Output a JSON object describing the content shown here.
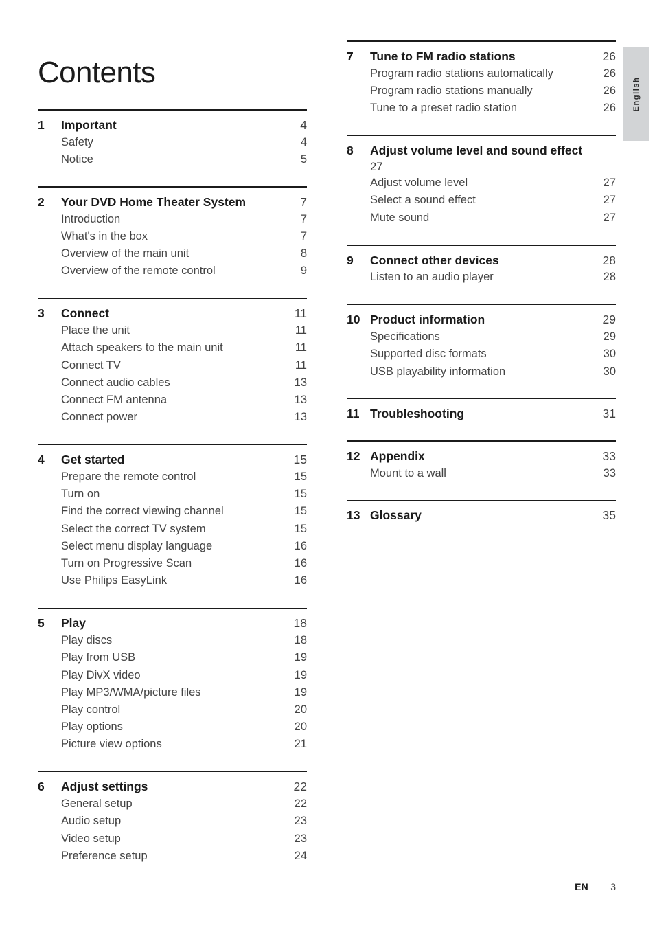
{
  "page_title": "Contents",
  "language_tab": "English",
  "footer": {
    "locale": "EN",
    "page_number": "3"
  },
  "columns": [
    {
      "id": "left",
      "sections": [
        {
          "number": "1",
          "title": "Important",
          "page": "4",
          "entries": [
            {
              "label": "Safety",
              "page": "4"
            },
            {
              "label": "Notice",
              "page": "5"
            }
          ]
        },
        {
          "number": "2",
          "title": "Your DVD Home Theater System",
          "page": "7",
          "entries": [
            {
              "label": "Introduction",
              "page": "7"
            },
            {
              "label": "What's in the box",
              "page": "7"
            },
            {
              "label": "Overview of the main unit",
              "page": "8"
            },
            {
              "label": "Overview of the remote control",
              "page": "9"
            }
          ]
        },
        {
          "number": "3",
          "title": "Connect",
          "page": "11",
          "entries": [
            {
              "label": "Place the unit",
              "page": "11"
            },
            {
              "label": "Attach speakers to the main unit",
              "page": "11"
            },
            {
              "label": "Connect TV",
              "page": "11"
            },
            {
              "label": "Connect audio cables",
              "page": "13"
            },
            {
              "label": "Connect FM antenna",
              "page": "13"
            },
            {
              "label": "Connect power",
              "page": "13"
            }
          ]
        },
        {
          "number": "4",
          "title": "Get started",
          "page": "15",
          "entries": [
            {
              "label": "Prepare the remote control",
              "page": "15"
            },
            {
              "label": "Turn on",
              "page": "15"
            },
            {
              "label": "Find the correct viewing channel",
              "page": "15"
            },
            {
              "label": "Select the correct TV system",
              "page": "15"
            },
            {
              "label": "Select menu display language",
              "page": "16"
            },
            {
              "label": "Turn on Progressive Scan",
              "page": "16"
            },
            {
              "label": "Use Philips EasyLink",
              "page": "16"
            }
          ]
        },
        {
          "number": "5",
          "title": "Play",
          "page": "18",
          "entries": [
            {
              "label": "Play discs",
              "page": "18"
            },
            {
              "label": "Play from USB",
              "page": "19"
            },
            {
              "label": "Play DivX video",
              "page": "19"
            },
            {
              "label": "Play MP3/WMA/picture files",
              "page": "19"
            },
            {
              "label": "Play control",
              "page": "20"
            },
            {
              "label": "Play options",
              "page": "20"
            },
            {
              "label": "Picture view options",
              "page": "21"
            }
          ]
        },
        {
          "number": "6",
          "title": "Adjust settings",
          "page": "22",
          "entries": [
            {
              "label": "General setup",
              "page": "22"
            },
            {
              "label": "Audio setup",
              "page": "23"
            },
            {
              "label": "Video setup",
              "page": "23"
            },
            {
              "label": "Preference setup",
              "page": "24"
            }
          ]
        }
      ]
    },
    {
      "id": "right",
      "sections": [
        {
          "number": "7",
          "title": "Tune to FM radio stations",
          "page": "26",
          "entries": [
            {
              "label": "Program radio stations automatically",
              "page": "26"
            },
            {
              "label": "Program radio stations manually",
              "page": "26"
            },
            {
              "label": "Tune to a preset radio station",
              "page": "26"
            }
          ]
        },
        {
          "number": "8",
          "title": "Adjust volume level and sound effect",
          "page": "27",
          "page_wraps": true,
          "entries": [
            {
              "label": "Adjust volume level",
              "page": "27"
            },
            {
              "label": "Select a sound effect",
              "page": "27"
            },
            {
              "label": "Mute sound",
              "page": "27"
            }
          ]
        },
        {
          "number": "9",
          "title": "Connect other devices",
          "page": "28",
          "entries": [
            {
              "label": "Listen to an audio player",
              "page": "28"
            }
          ]
        },
        {
          "number": "10",
          "title": "Product information",
          "page": "29",
          "entries": [
            {
              "label": "Specifications",
              "page": "29"
            },
            {
              "label": "Supported disc formats",
              "page": "30"
            },
            {
              "label": "USB playability information",
              "page": "30"
            }
          ]
        },
        {
          "number": "11",
          "title": "Troubleshooting",
          "page": "31",
          "entries": []
        },
        {
          "number": "12",
          "title": "Appendix",
          "page": "33",
          "entries": [
            {
              "label": "Mount to a wall",
              "page": "33"
            }
          ]
        },
        {
          "number": "13",
          "title": "Glossary",
          "page": "35",
          "entries": []
        }
      ]
    }
  ]
}
